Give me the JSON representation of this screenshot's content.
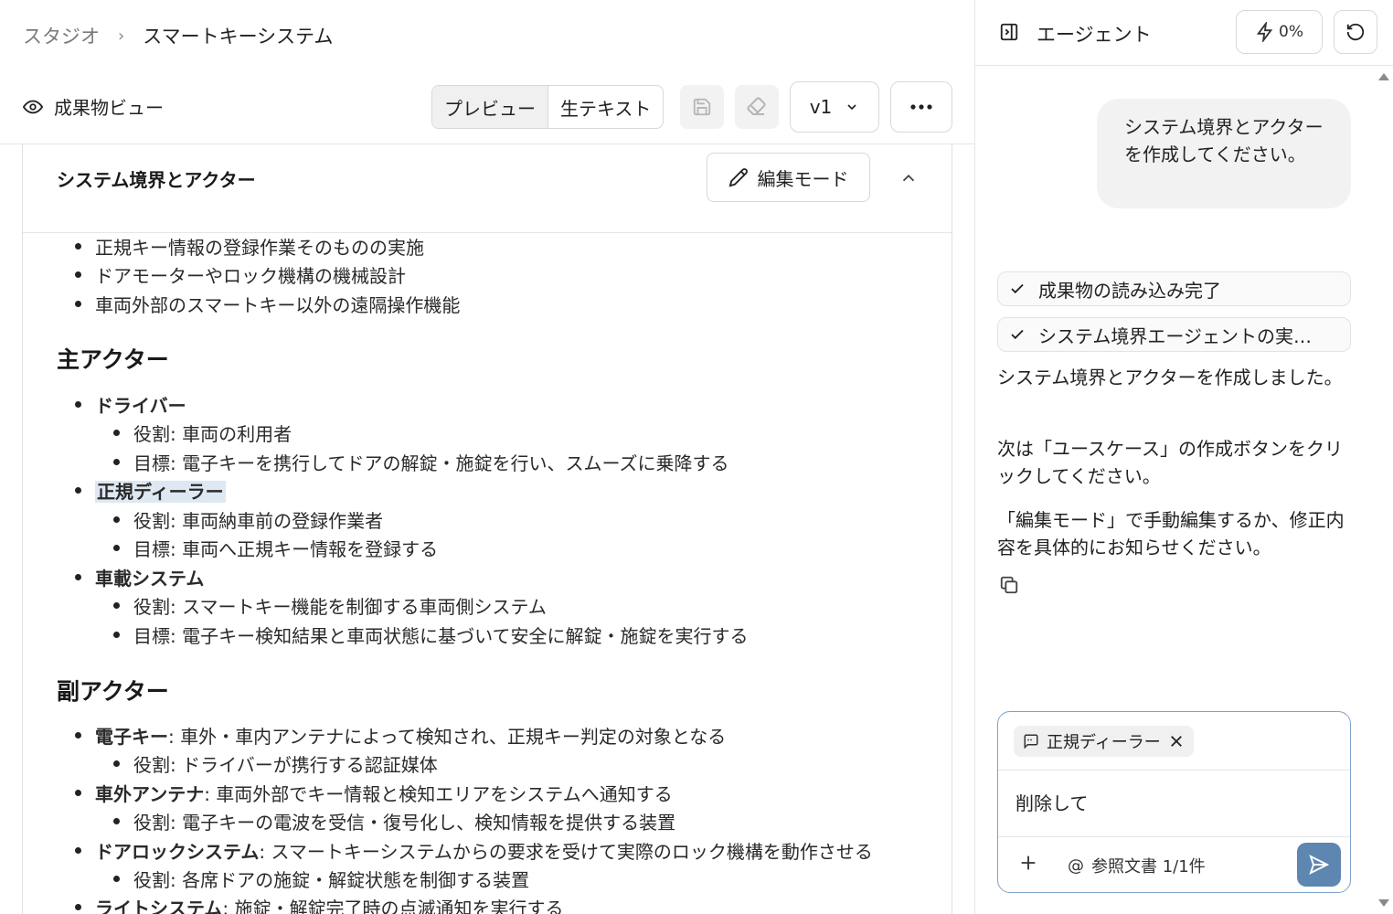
{
  "breadcrumb": {
    "root": "スタジオ",
    "separator": "›",
    "current": "スマートキーシステム"
  },
  "viewbar": {
    "title": "成果物ビュー",
    "tabs": [
      "プレビュー",
      "生テキスト"
    ],
    "version": "v1"
  },
  "card": {
    "title": "システム境界とアクター",
    "edit_label": "編集モード"
  },
  "content": {
    "excluded_items": [
      "正規キー情報の登録作業そのものの実施",
      "ドアモーターやロック機構の機械設計",
      "車両外部のスマートキー以外の遠隔操作機能"
    ],
    "primary_heading": "主アクター",
    "primary_actors": [
      {
        "name": "ドライバー",
        "role": "役割: 車両の利用者",
        "goal": "目標: 電子キーを携行してドアの解錠・施錠を行い、スムーズに乗降する"
      },
      {
        "name": "正規ディーラー",
        "role": "役割: 車両納車前の登録作業者",
        "goal": "目標: 車両へ正規キー情報を登録する"
      },
      {
        "name": "車載システム",
        "role": "役割: スマートキー機能を制御する車両側システム",
        "goal": "目標: 電子キー検知結果と車両状態に基づいて安全に解錠・施錠を実行する"
      }
    ],
    "secondary_heading": "副アクター",
    "secondary_actors": [
      {
        "name": "電子キー",
        "desc": ": 車外・車内アンテナによって検知され、正規キー判定の対象となる",
        "role": "役割: ドライバーが携行する認証媒体"
      },
      {
        "name": "車外アンテナ",
        "desc": ": 車両外部でキー情報と検知エリアをシステムへ通知する",
        "role": "役割: 電子キーの電波を受信・復号化し、検知情報を提供する装置"
      },
      {
        "name": "ドアロックシステム",
        "desc": ": スマートキーシステムからの要求を受けて実際のロック機構を動作させる",
        "role": "役割: 各席ドアの施錠・解錠状態を制御する装置"
      },
      {
        "name": "ライトシステム",
        "desc": ": 施錠・解錠完了時の点滅通知を実行する"
      }
    ]
  },
  "agent": {
    "title": "エージェント",
    "credit": "0%",
    "user_message": "システム境界とアクターを作成してください。",
    "steps": [
      "成果物の読み込み完了",
      "システム境界エージェントの実…"
    ],
    "replies": [
      "システム境界とアクターを作成しました。",
      "次は「ユースケース」の作成ボタンをクリックしてください。",
      "「編集モード」で手動編集するか、修正内容を具体的にお知らせください。"
    ],
    "composer": {
      "chip_label": "正規ディーラー",
      "text": "削除して",
      "reference": "参照文書 1/1件"
    }
  },
  "colors": {
    "accent": "#5d86b1",
    "highlight": "#dde8f2",
    "composer_border": "#7fa3c9"
  }
}
